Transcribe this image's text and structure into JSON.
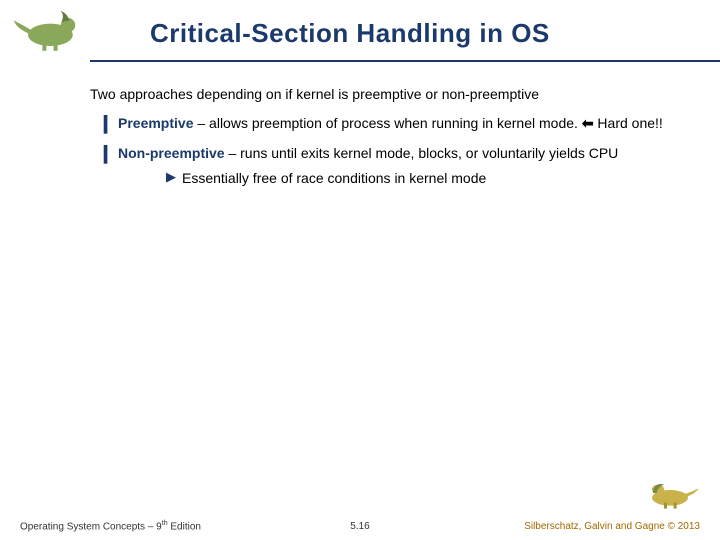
{
  "title": "Critical-Section Handling in OS",
  "intro": "Two approaches depending on if kernel is preemptive or non-preemptive",
  "bullets": [
    {
      "term": "Preemptive",
      "rest": " – allows preemption of process when running in kernel mode. ",
      "arrow": "⬅",
      "tail": " Hard one!!"
    },
    {
      "term": "Non-preemptive",
      "rest": " – runs until exits kernel mode, blocks, or voluntarily yields CPU",
      "sub": "Essentially free of race conditions in kernel mode"
    }
  ],
  "footer": {
    "left_a": "Operating System Concepts – 9",
    "left_sup": "th",
    "left_b": " Edition",
    "center": "5.16",
    "right": "Silberschatz, Galvin and Gagne © 2013"
  }
}
